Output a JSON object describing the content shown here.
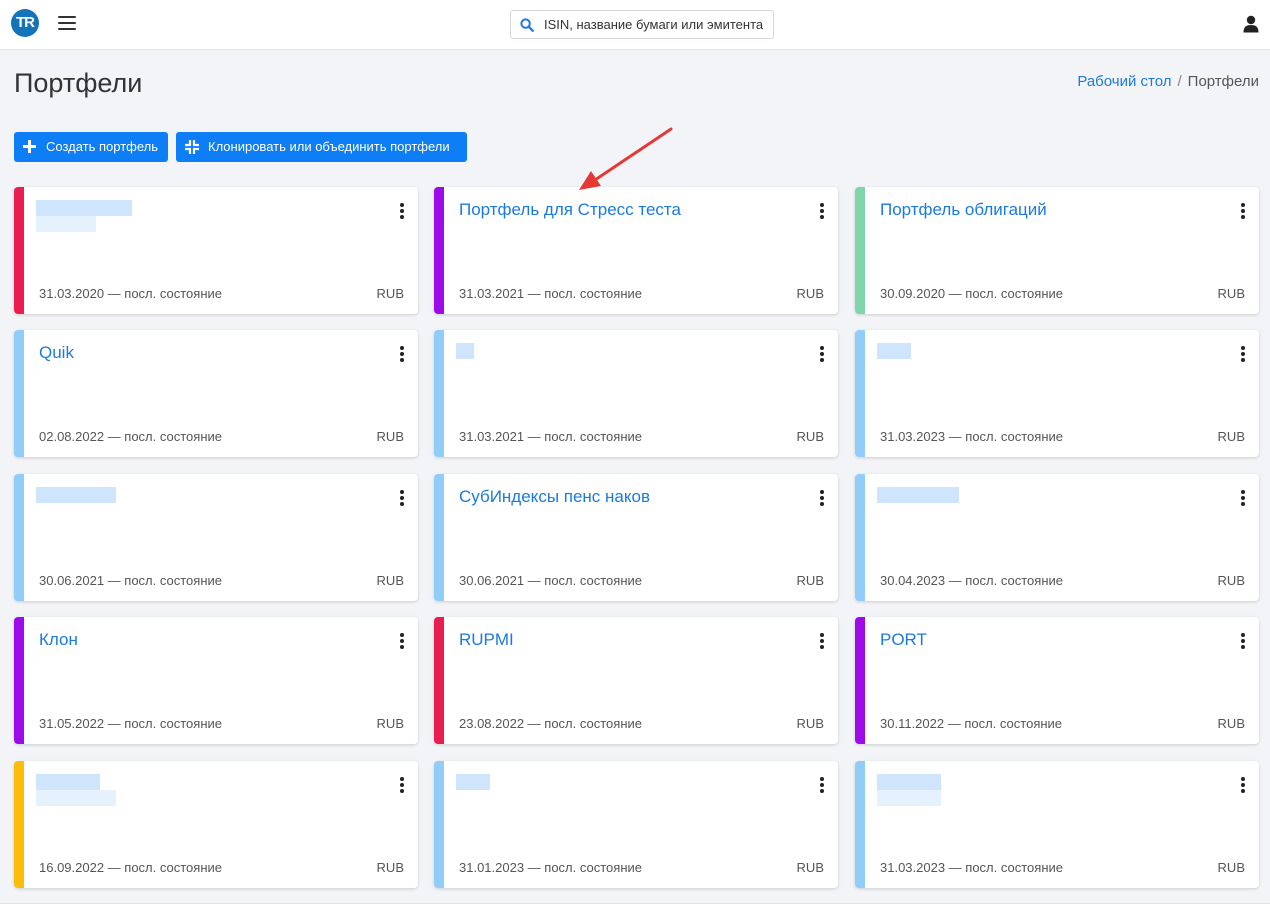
{
  "header": {
    "logo_text": "TR",
    "search_placeholder": "ISIN, название бумаги или эмитента"
  },
  "page": {
    "title": "Портфели",
    "breadcrumb": {
      "home": "Рабочий стол",
      "separator": "/",
      "current": "Портфели"
    }
  },
  "actions": {
    "create_label": "Создать портфель",
    "clone_label": "Клонировать или объединить портфели"
  },
  "colors": {
    "accent": "#0d7ef5",
    "link": "#1b7ae0",
    "stripe_red": "#e91e4f",
    "stripe_purple": "#9c0be8",
    "stripe_green": "#7fd6a9",
    "stripe_lightblue": "#90cdf9",
    "stripe_yellow": "#fbbd08"
  },
  "annotation_arrow_color": "#e53935",
  "cards": [
    {
      "title": "",
      "blurred": true,
      "stripe": "#e91e4f",
      "date": "31.03.2020 — посл. состояние",
      "currency": "RUB"
    },
    {
      "title": "Портфель для Стресс теста",
      "blurred": false,
      "stripe": "#9c0be8",
      "date": "31.03.2021 — посл. состояние",
      "currency": "RUB"
    },
    {
      "title": "Портфель облигаций",
      "blurred": false,
      "stripe": "#7fd6a9",
      "date": "30.09.2020 — посл. состояние",
      "currency": "RUB"
    },
    {
      "title": "Quik",
      "blurred": false,
      "stripe": "#90cdf9",
      "date": "02.08.2022 — посл. состояние",
      "currency": "RUB"
    },
    {
      "title": "",
      "blurred": true,
      "stripe": "#90cdf9",
      "date": "31.03.2021 — посл. состояние",
      "currency": "RUB"
    },
    {
      "title": "",
      "blurred": true,
      "stripe": "#90cdf9",
      "date": "31.03.2023 — посл. состояние",
      "currency": "RUB"
    },
    {
      "title": "",
      "blurred": true,
      "stripe": "#90cdf9",
      "date": "30.06.2021 — посл. состояние",
      "currency": "RUB"
    },
    {
      "title": "СубИндексы пенс наков",
      "blurred": false,
      "stripe": "#90cdf9",
      "date": "30.06.2021 — посл. состояние",
      "currency": "RUB"
    },
    {
      "title": "",
      "blurred": true,
      "stripe": "#90cdf9",
      "date": "30.04.2023 — посл. состояние",
      "currency": "RUB"
    },
    {
      "title": "Клон",
      "blurred": false,
      "stripe": "#9c0be8",
      "date": "31.05.2022 — посл. состояние",
      "currency": "RUB"
    },
    {
      "title": "RUPMI",
      "blurred": false,
      "stripe": "#e91e4f",
      "date": "23.08.2022 — посл. состояние",
      "currency": "RUB"
    },
    {
      "title": "PORT",
      "blurred": false,
      "stripe": "#9c0be8",
      "date": "30.11.2022 — посл. состояние",
      "currency": "RUB"
    },
    {
      "title": "",
      "blurred": true,
      "stripe": "#fbbd08",
      "date": "16.09.2022 — посл. состояние",
      "currency": "RUB"
    },
    {
      "title": "",
      "blurred": true,
      "stripe": "#90cdf9",
      "date": "31.01.2023 — посл. состояние",
      "currency": "RUB"
    },
    {
      "title": "",
      "blurred": true,
      "stripe": "#90cdf9",
      "date": "31.03.2023 — посл. состояние",
      "currency": "RUB"
    }
  ]
}
